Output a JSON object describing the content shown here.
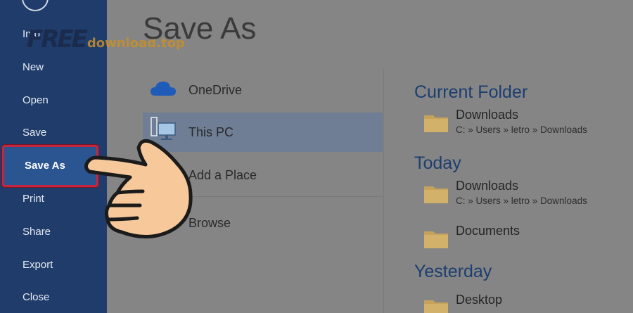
{
  "sidebar": {
    "items": [
      {
        "label": "Info"
      },
      {
        "label": "New"
      },
      {
        "label": "Open"
      },
      {
        "label": "Save"
      },
      {
        "label": "Save As",
        "active": true
      },
      {
        "label": "Print"
      },
      {
        "label": "Share"
      },
      {
        "label": "Export"
      },
      {
        "label": "Close"
      }
    ]
  },
  "watermark": {
    "prefix": "FREE",
    "rest": "download.top"
  },
  "main": {
    "title": "Save As"
  },
  "places": [
    {
      "label": "OneDrive",
      "icon": "cloud-icon"
    },
    {
      "label": "This PC",
      "icon": "computer-icon",
      "selected": true
    },
    {
      "label": "Add a Place",
      "icon": "add-place-icon"
    },
    {
      "label": "Browse",
      "icon": "folder-browse-icon"
    }
  ],
  "recent": {
    "groups": [
      {
        "heading": "Current Folder",
        "items": [
          {
            "name": "Downloads",
            "path": "C: » Users » letro » Downloads"
          }
        ]
      },
      {
        "heading": "Today",
        "items": [
          {
            "name": "Downloads",
            "path": "C: » Users » letro » Downloads"
          },
          {
            "name": "Documents",
            "path": ""
          }
        ]
      },
      {
        "heading": "Yesterday",
        "items": [
          {
            "name": "Desktop",
            "path": ""
          }
        ]
      }
    ]
  },
  "colors": {
    "sidebar": "#1f3c6b",
    "active_item": "#2a5591",
    "highlight_border": "#c3273f",
    "selected_place": "#6f7e95",
    "heading": "#1c3e70",
    "folder": "#c6a35c",
    "overlay_bg": "#858585"
  }
}
